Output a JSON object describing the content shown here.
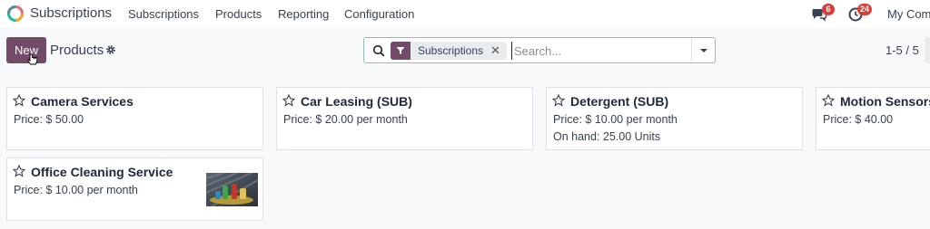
{
  "navbar": {
    "app_name": "Subscriptions",
    "menu": [
      "Subscriptions",
      "Products",
      "Reporting",
      "Configuration"
    ],
    "messages_badge": "6",
    "activities_badge": "24",
    "company": "My Com"
  },
  "control": {
    "new_label": "New",
    "breadcrumb": "Products",
    "search": {
      "facet": "Subscriptions",
      "placeholder": "Search..."
    },
    "pager": "1-5 / 5"
  },
  "cards": [
    {
      "name": "Camera Services",
      "price": "Price: $ 50.00",
      "extra": ""
    },
    {
      "name": "Car Leasing (SUB)",
      "price": "Price: $ 20.00 per month",
      "extra": ""
    },
    {
      "name": "Detergent (SUB)",
      "price": "Price: $ 10.00 per month",
      "extra": "On hand: 25.00 Units"
    },
    {
      "name": "Motion Sensors",
      "price": "Price: $ 40.00",
      "extra": ""
    },
    {
      "name": "Office Cleaning Service",
      "price": "Price: $ 10.00 per month",
      "extra": ""
    }
  ],
  "colors": {
    "brand": "#714b67",
    "badge": "#d9403a",
    "search_border": "#8fbfbc"
  },
  "icons": [
    "odoo-logo-icon",
    "chat-icon",
    "clock-icon",
    "gear-icon",
    "search-icon",
    "filter-icon",
    "close-icon",
    "caret-down-icon",
    "star-icon"
  ]
}
